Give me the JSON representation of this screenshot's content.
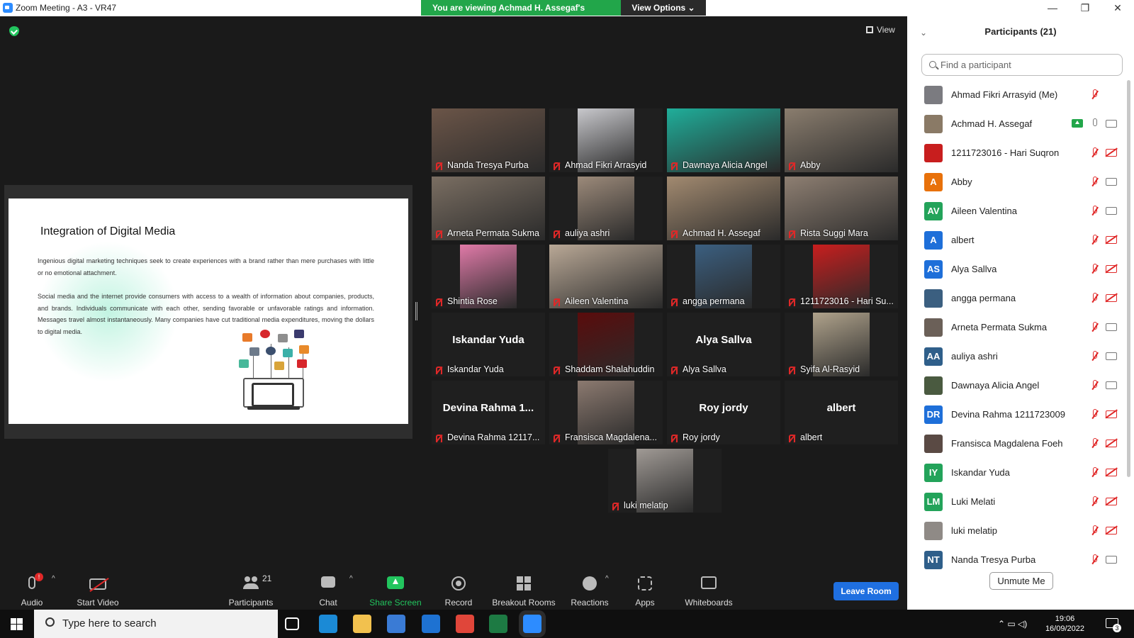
{
  "window": {
    "title": "Zoom Meeting - A3 - VR47",
    "banner": "You are viewing Achmad H. Assegaf's screen",
    "view_options": "View Options ⌄",
    "minimize": "—",
    "maximize": "❐",
    "close": "✕"
  },
  "meeting": {
    "view_label": "View"
  },
  "slide": {
    "title": "Integration of Digital Media",
    "para1": "Ingenious digital marketing techniques seek to create experiences with a brand rather than mere purchases with little or no emotional attachment.",
    "para2": "Social media and the internet provide consumers with access to a wealth of information about companies, products, and brands. Individuals communicate with each other, sending favorable or unfavorable ratings and information. Messages travel almost instantaneously. Many companies have cut traditional media expenditures, moving the dollars to digital media."
  },
  "video_tiles": [
    {
      "label": "Nanda Tresya Purba",
      "photo_color": "#6b5548",
      "video": true
    },
    {
      "label": "Ahmad Fikri Arrasyid",
      "photo_color": "#c8c8cc",
      "video": true
    },
    {
      "label": "Dawnaya Alicia Angel",
      "photo_color": "#1fae9a",
      "video": true
    },
    {
      "label": "Abby",
      "photo_color": "#8a7d6e",
      "video": true
    },
    {
      "label": "Arneta Permata Sukma",
      "photo_color": "#7a6e62",
      "video": true
    },
    {
      "label": "auliya ashri",
      "photo_color": "#9c8a7a",
      "video": true
    },
    {
      "label": "Achmad H. Assegaf",
      "photo_color": "#a28a70",
      "video": true,
      "active": true
    },
    {
      "label": "Rista Suggi Mara",
      "photo_color": "#8e7f72",
      "video": true
    },
    {
      "label": "Shintia Rose",
      "photo_color": "#e07aa8",
      "video": true
    },
    {
      "label": "Aileen Valentina",
      "photo_color": "#b9a896",
      "video": true
    },
    {
      "label": "angga permana",
      "photo_color": "#3b5f80",
      "video": true
    },
    {
      "label": "1211723016 - Hari Su...",
      "photo_color": "#c81e1e",
      "video": true
    },
    {
      "label": "Iskandar Yuda",
      "display_name": "Iskandar Yuda",
      "video": false
    },
    {
      "label": "Shaddam Shalahuddin",
      "photo_color": "#5a0c0c",
      "video": true
    },
    {
      "label": "Alya Sallva",
      "display_name": "Alya Sallva",
      "video": false
    },
    {
      "label": "Syifa Al-Rasyid",
      "photo_color": "#b0a38c",
      "video": true
    },
    {
      "label": "Devina Rahma 12117...",
      "display_name": "Devina Rahma 1...",
      "video": false
    },
    {
      "label": "Fransisca Magdalena...",
      "photo_color": "#8c7a70",
      "video": true
    },
    {
      "label": "Roy jordy",
      "display_name": "Roy jordy",
      "video": false
    },
    {
      "label": "albert",
      "display_name": "albert",
      "video": false
    },
    {
      "label": "luki melatip",
      "photo_color": "#a09a95",
      "video": true
    }
  ],
  "participants_panel": {
    "title": "Participants (21)",
    "search_placeholder": "Find a participant",
    "unmute_label": "Unmute Me",
    "list": [
      {
        "name": "Ahmad Fikri Arrasyid (Me)",
        "avatar": "",
        "avatar_color": "#7b7b80",
        "mic": "muted",
        "cam": "none"
      },
      {
        "name": "Achmad H. Assegaf",
        "avatar": "",
        "avatar_color": "#8a7a66",
        "mic": "on",
        "cam": "on",
        "sharing": true
      },
      {
        "name": "1211723016 - Hari Suqron",
        "avatar": "",
        "avatar_color": "#c81e1e",
        "mic": "muted",
        "cam": "off"
      },
      {
        "name": "Abby",
        "avatar": "A",
        "avatar_color": "#e8710a",
        "mic": "muted",
        "cam": "on"
      },
      {
        "name": "Aileen Valentina",
        "avatar": "AV",
        "avatar_color": "#23a35a",
        "mic": "muted",
        "cam": "on"
      },
      {
        "name": "albert",
        "avatar": "A",
        "avatar_color": "#1e6fd9",
        "mic": "muted",
        "cam": "off"
      },
      {
        "name": "Alya Sallva",
        "avatar": "AS",
        "avatar_color": "#1e6fd9",
        "mic": "muted",
        "cam": "off"
      },
      {
        "name": "angga permana",
        "avatar": "",
        "avatar_color": "#3b5f80",
        "mic": "muted",
        "cam": "off"
      },
      {
        "name": "Arneta Permata Sukma",
        "avatar": "",
        "avatar_color": "#6b6058",
        "mic": "muted",
        "cam": "on"
      },
      {
        "name": "auliya ashri",
        "avatar": "AA",
        "avatar_color": "#2f5f8a",
        "mic": "muted",
        "cam": "on"
      },
      {
        "name": "Dawnaya Alicia Angel",
        "avatar": "",
        "avatar_color": "#4a5a40",
        "mic": "muted",
        "cam": "on"
      },
      {
        "name": "Devina Rahma 1211723009",
        "avatar": "DR",
        "avatar_color": "#1e6fd9",
        "mic": "muted",
        "cam": "off"
      },
      {
        "name": "Fransisca Magdalena Foeh",
        "avatar": "",
        "avatar_color": "#5a4a44",
        "mic": "muted",
        "cam": "off"
      },
      {
        "name": "Iskandar Yuda",
        "avatar": "IY",
        "avatar_color": "#23a35a",
        "mic": "muted",
        "cam": "off"
      },
      {
        "name": "Luki Melati",
        "avatar": "LM",
        "avatar_color": "#23a35a",
        "mic": "muted",
        "cam": "off"
      },
      {
        "name": "luki melatip",
        "avatar": "",
        "avatar_color": "#8f8a86",
        "mic": "muted",
        "cam": "off"
      },
      {
        "name": "Nanda Tresya Purba",
        "avatar": "NT",
        "avatar_color": "#2f5f8a",
        "mic": "muted",
        "cam": "on"
      }
    ]
  },
  "toolbar": {
    "audio": "Audio",
    "audio_badge": "!",
    "start_video": "Start Video",
    "participants": "Participants",
    "participants_count": "21",
    "chat": "Chat",
    "share_screen": "Share Screen",
    "record": "Record",
    "breakout_rooms": "Breakout Rooms",
    "reactions": "Reactions",
    "apps": "Apps",
    "whiteboards": "Whiteboards",
    "leave": "Leave Room",
    "caret": "^"
  },
  "taskbar": {
    "search_placeholder": "Type here to search",
    "time": "19:06",
    "date": "16/09/2022",
    "notification_count": "3",
    "apps": [
      {
        "name": "task-view",
        "color": "#0f0f0f"
      },
      {
        "name": "edge",
        "color": "#1b8ad6"
      },
      {
        "name": "file-explorer",
        "color": "#f2c14e"
      },
      {
        "name": "microsoft-store",
        "color": "#3a7bd5"
      },
      {
        "name": "mail",
        "color": "#1e72d2"
      },
      {
        "name": "chrome",
        "color": "#e0463a"
      },
      {
        "name": "excel",
        "color": "#1d7a43"
      },
      {
        "name": "zoom",
        "color": "#2d8cff"
      }
    ]
  }
}
